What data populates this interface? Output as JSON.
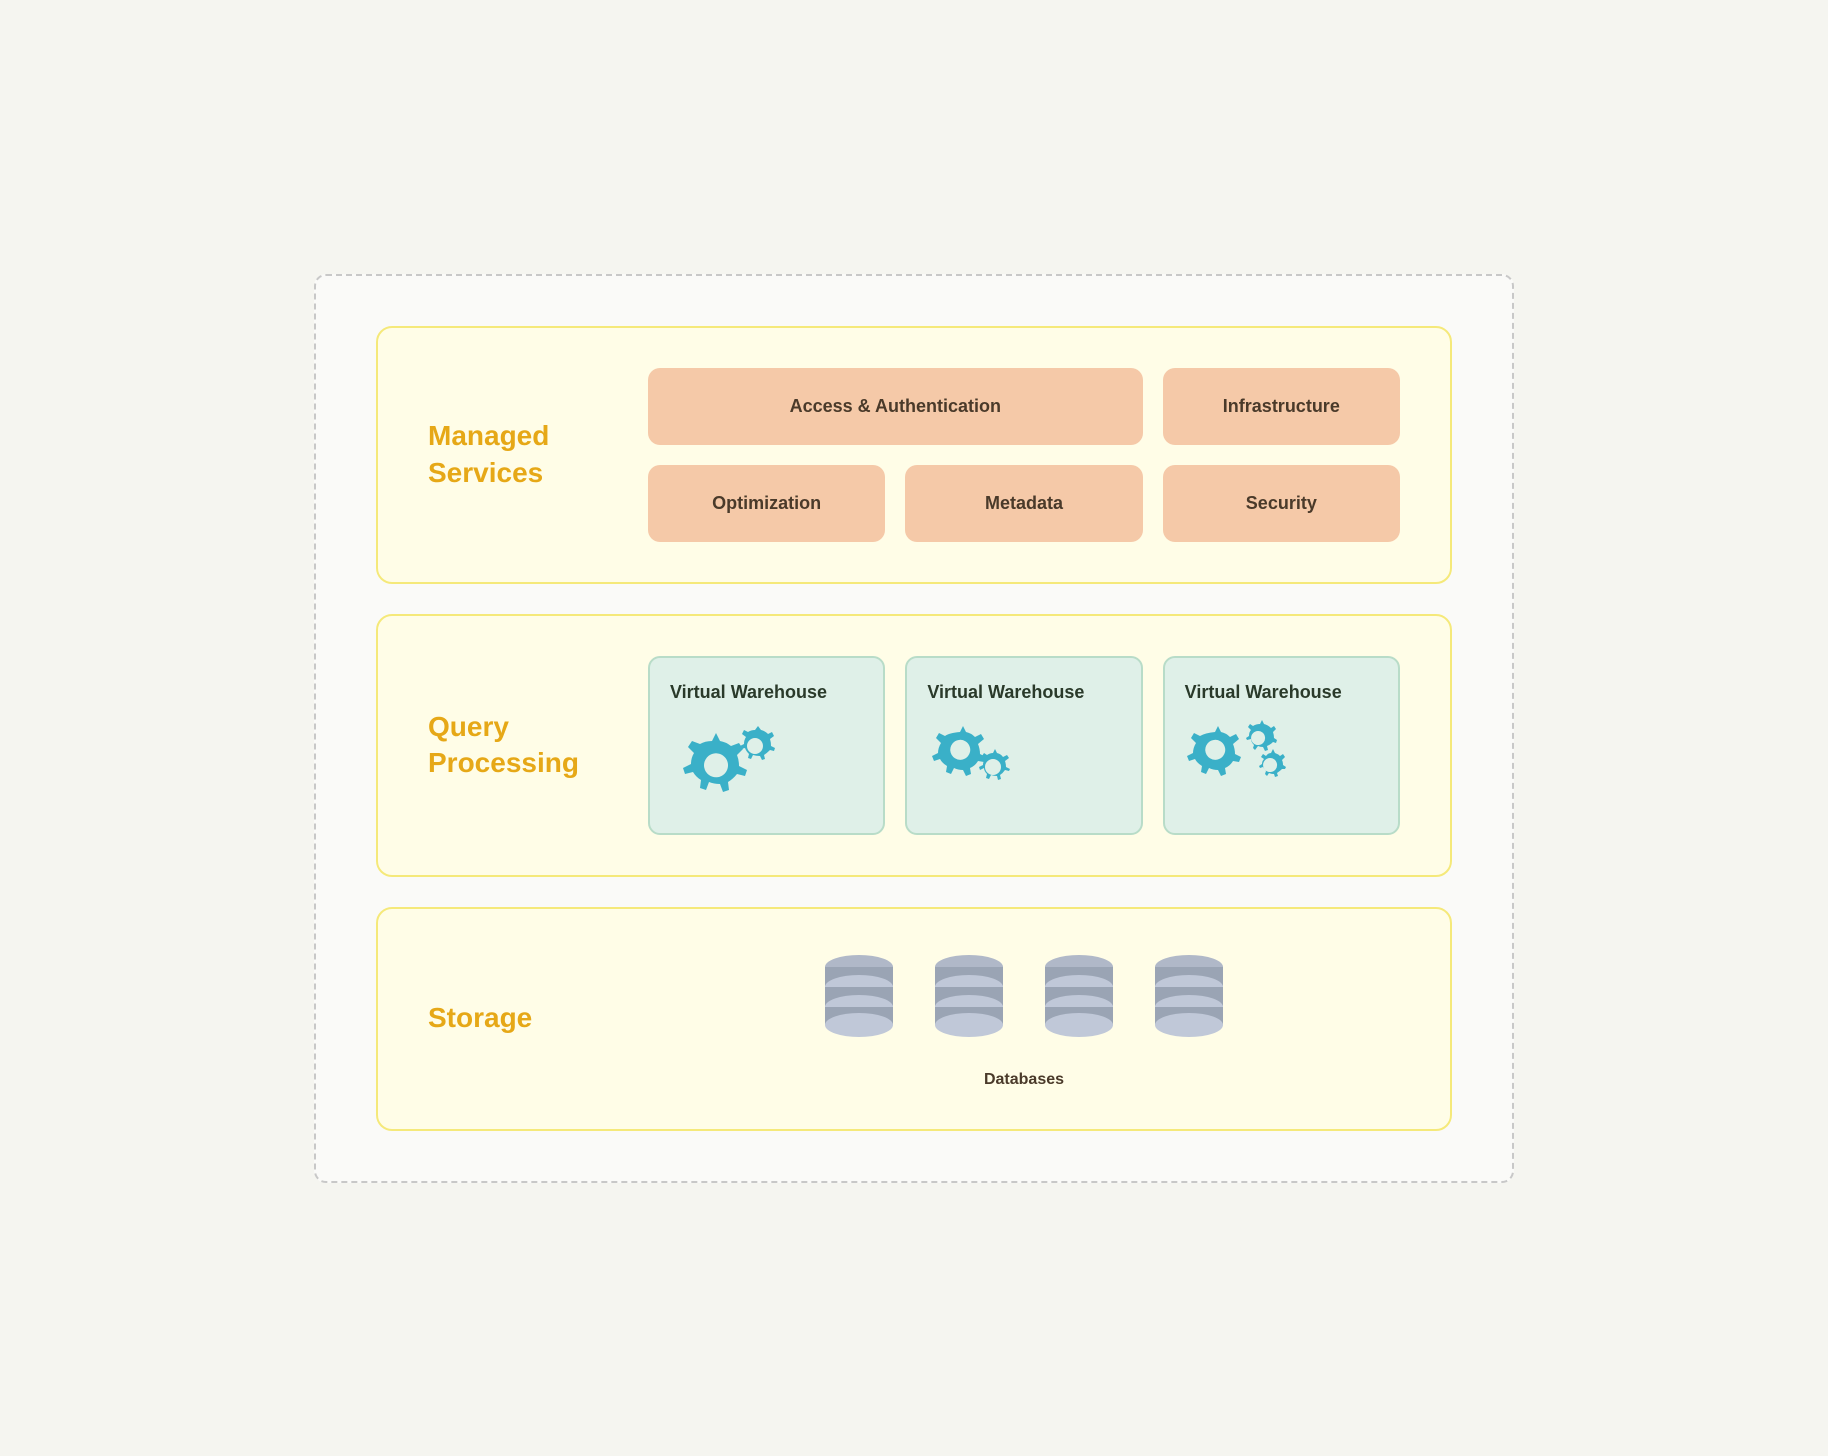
{
  "outer": {
    "background_note": "dashed border container"
  },
  "managed_services": {
    "title_line1": "Managed",
    "title_line2": "Services",
    "cards": {
      "row1": [
        {
          "id": "access-auth",
          "label": "Access & Authentication",
          "span2": true
        },
        {
          "id": "infrastructure",
          "label": "Infrastructure",
          "span2": false
        }
      ],
      "row2": [
        {
          "id": "optimization",
          "label": "Optimization"
        },
        {
          "id": "metadata",
          "label": "Metadata"
        },
        {
          "id": "security",
          "label": "Security"
        }
      ]
    }
  },
  "query_processing": {
    "title_line1": "Query",
    "title_line2": "Processing",
    "warehouses": [
      {
        "id": "vw1",
        "label": "Virtual Warehouse"
      },
      {
        "id": "vw2",
        "label": "Virtual Warehouse"
      },
      {
        "id": "vw3",
        "label": "Virtual Warehouse"
      }
    ]
  },
  "storage": {
    "title": "Storage",
    "databases_label": "Databases",
    "db_count": 4
  }
}
